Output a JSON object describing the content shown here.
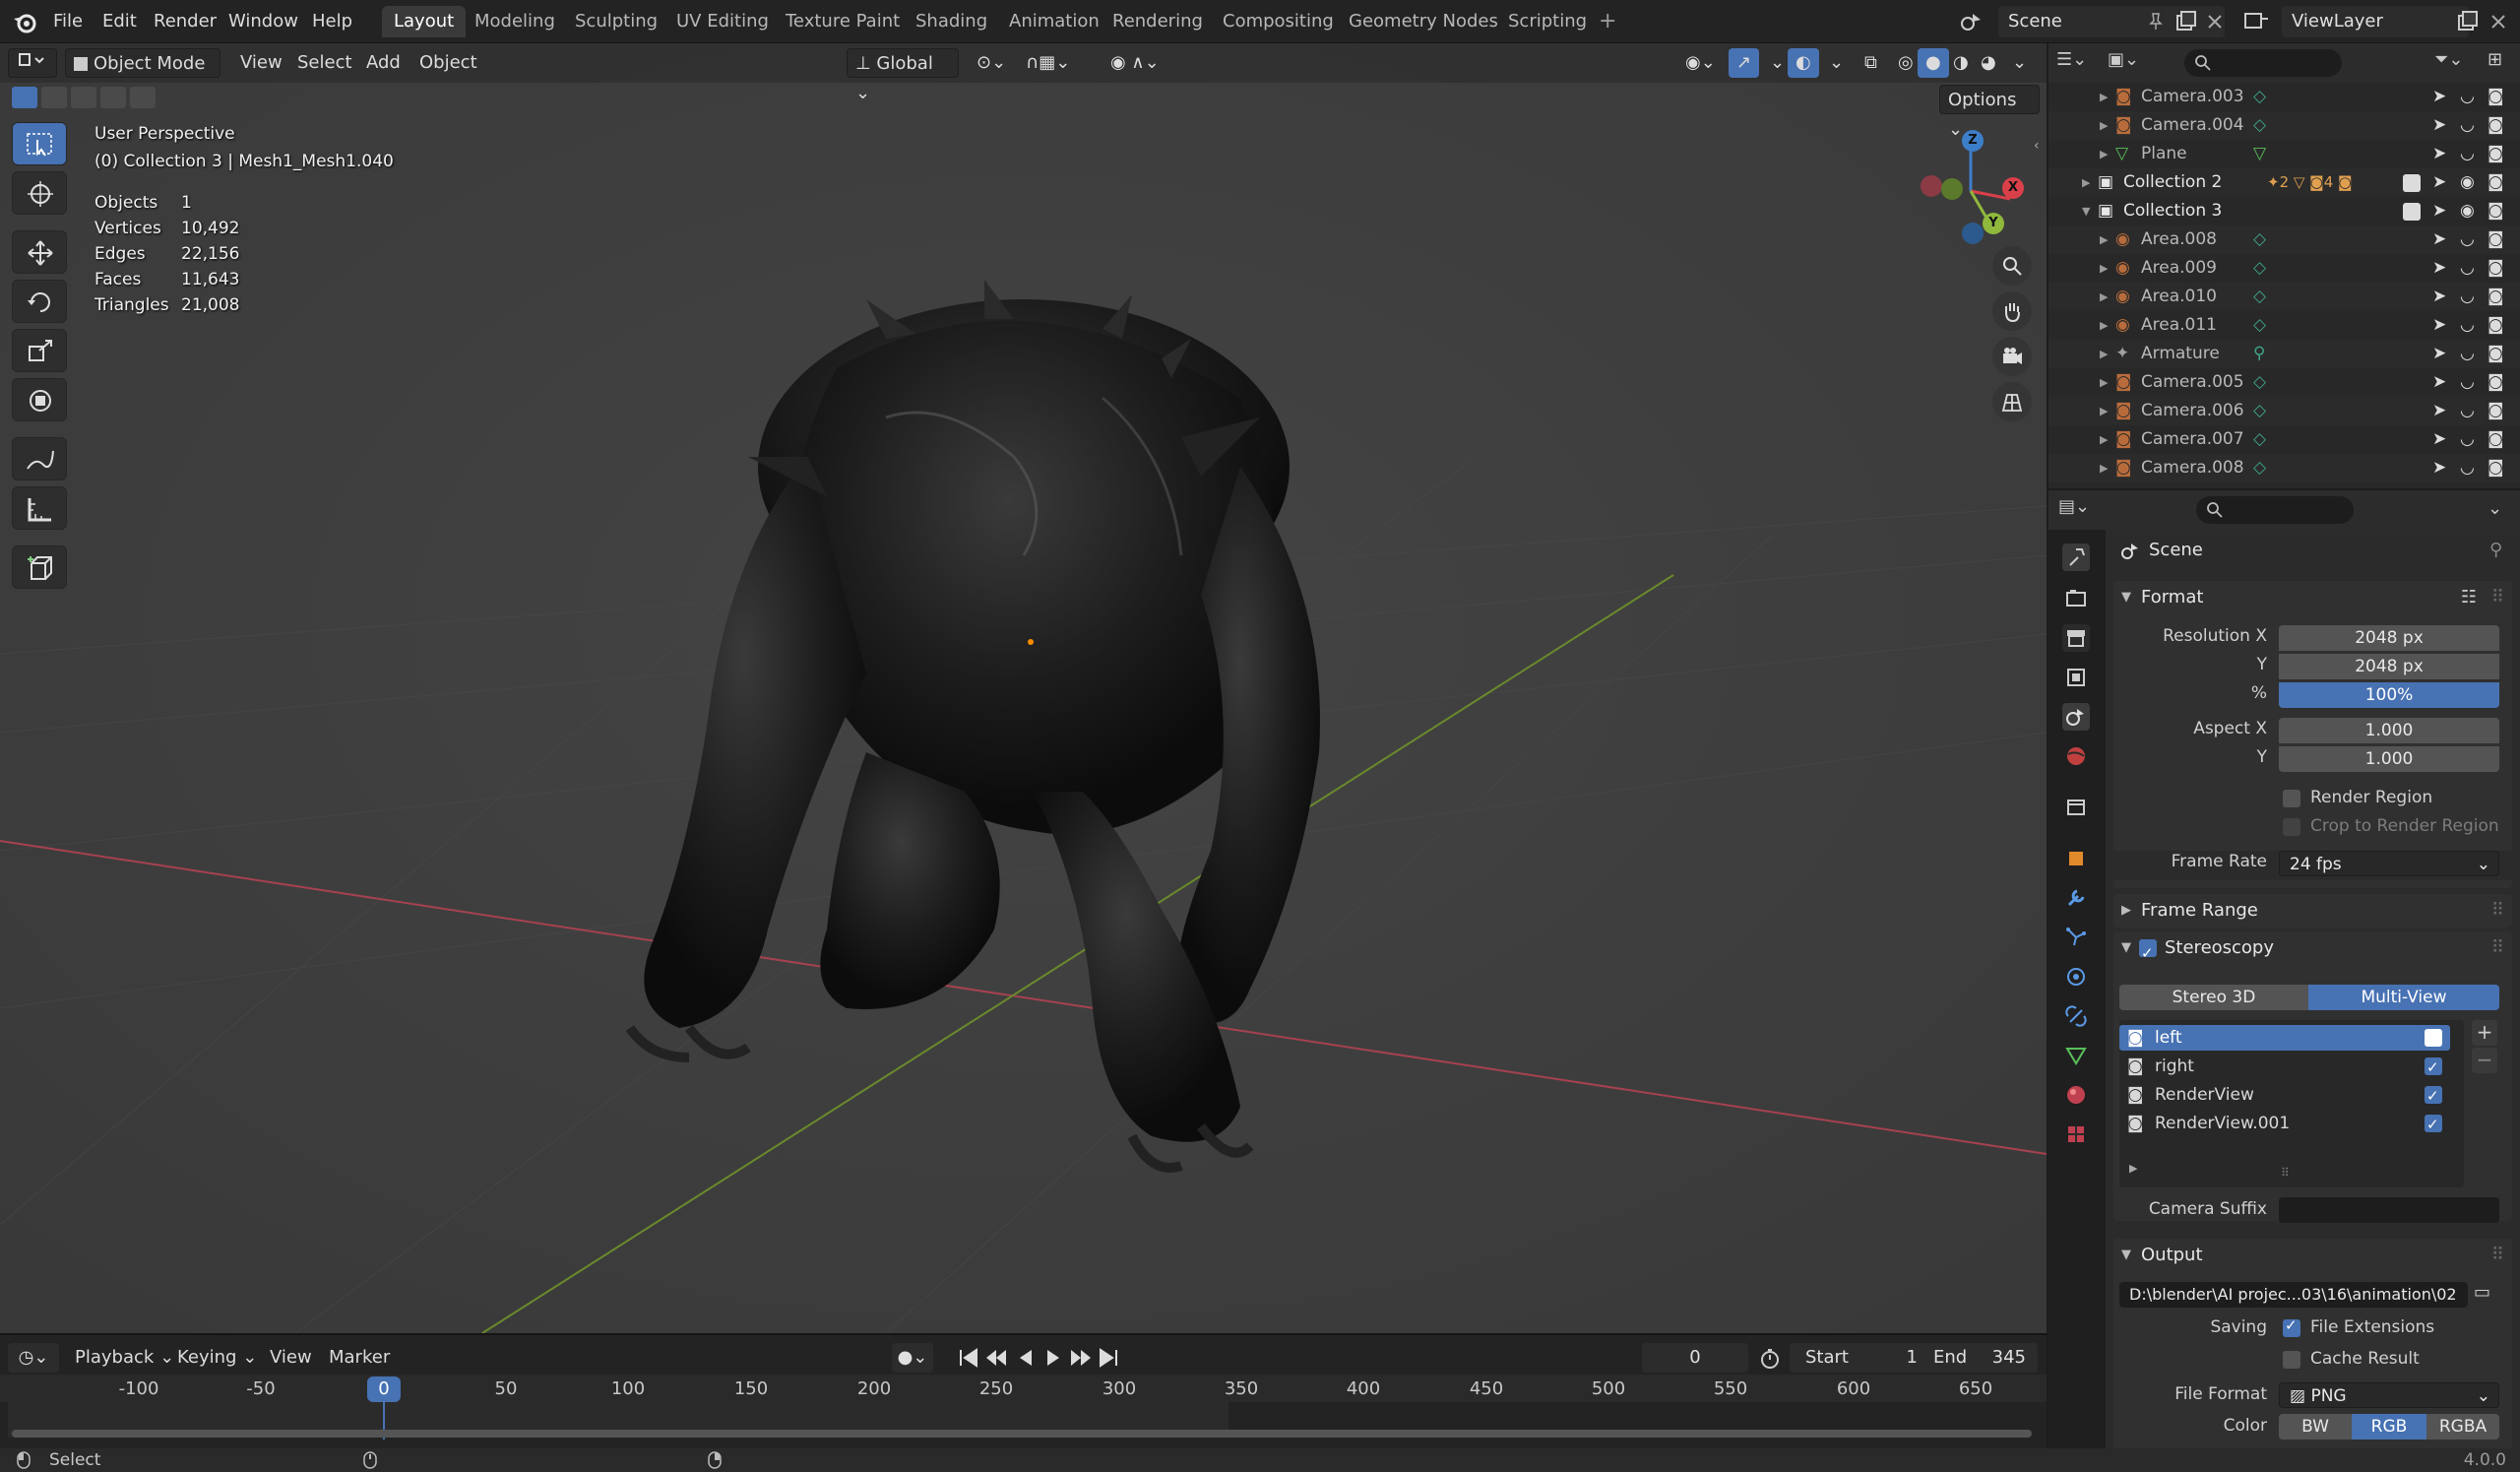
{
  "topbar": {
    "menus": [
      "File",
      "Edit",
      "Render",
      "Window",
      "Help"
    ],
    "workspaces": [
      "Layout",
      "Modeling",
      "Sculpting",
      "UV Editing",
      "Texture Paint",
      "Shading",
      "Animation",
      "Rendering",
      "Compositing",
      "Geometry Nodes",
      "Scripting"
    ],
    "active_workspace": "Layout",
    "add_workspace": "+",
    "scene": "Scene",
    "view_layer": "ViewLayer"
  },
  "viewport": {
    "mode": "Object Mode",
    "menus": [
      "View",
      "Select",
      "Add",
      "Object"
    ],
    "transform_orientation": "Global",
    "options": "Options",
    "view_name": "User Perspective",
    "active_object": "(0) Collection 3 | Mesh1_Mesh1.040",
    "stats": [
      {
        "label": "Objects",
        "value": "1"
      },
      {
        "label": "Vertices",
        "value": "10,492"
      },
      {
        "label": "Edges",
        "value": "22,156"
      },
      {
        "label": "Faces",
        "value": "11,643"
      },
      {
        "label": "Triangles",
        "value": "21,008"
      }
    ],
    "gizmo": {
      "z": "Z",
      "y": "Y",
      "x": "X"
    }
  },
  "timeline": {
    "menus": [
      "Playback",
      "Keying",
      "View",
      "Marker"
    ],
    "current_frame": "0",
    "start_label": "Start",
    "start": "1",
    "end_label": "End",
    "end": "345",
    "ruler": [
      "-100",
      "-50",
      "0",
      "50",
      "100",
      "150",
      "200",
      "250",
      "300",
      "350",
      "400",
      "450",
      "500",
      "550",
      "600",
      "650"
    ]
  },
  "statusbar": {
    "left": "Select",
    "version": "4.0.0"
  },
  "outliner": {
    "rows": [
      {
        "name": "Camera.003",
        "type": "camera"
      },
      {
        "name": "Camera.004",
        "type": "camera"
      },
      {
        "name": "Plane",
        "type": "mesh"
      },
      {
        "name": "Collection 2",
        "type": "collection"
      },
      {
        "name": "Collection 3",
        "type": "collection"
      },
      {
        "name": "Area.008",
        "type": "light"
      },
      {
        "name": "Area.009",
        "type": "light"
      },
      {
        "name": "Area.010",
        "type": "light"
      },
      {
        "name": "Area.011",
        "type": "light"
      },
      {
        "name": "Armature",
        "type": "armature"
      },
      {
        "name": "Camera.005",
        "type": "camera"
      },
      {
        "name": "Camera.006",
        "type": "camera"
      },
      {
        "name": "Camera.007",
        "type": "camera"
      },
      {
        "name": "Camera.008",
        "type": "camera"
      }
    ],
    "collection2_badges": [
      "2",
      "4"
    ]
  },
  "properties": {
    "context": "Scene",
    "format": {
      "title": "Format",
      "resolution_x_label": "Resolution X",
      "resolution_x": "2048 px",
      "y_label": "Y",
      "resolution_y": "2048 px",
      "percent_label": "%",
      "percent": "100%",
      "aspect_x_label": "Aspect X",
      "aspect_x": "1.000",
      "aspect_y_label": "Y",
      "aspect_y": "1.000",
      "render_region": "Render Region",
      "crop": "Crop to Render Region",
      "frame_rate_label": "Frame Rate",
      "frame_rate": "24 fps"
    },
    "frame_range": "Frame Range",
    "stereoscopy": {
      "title": "Stereoscopy",
      "mode_a": "Stereo 3D",
      "mode_b": "Multi-View",
      "views": [
        "left",
        "right",
        "RenderView",
        "RenderView.001"
      ],
      "camera_suffix_label": "Camera Suffix",
      "camera_suffix": ""
    },
    "output": {
      "title": "Output",
      "path": "D:\\blender\\AI projec...03\\16\\animation\\02",
      "saving_label": "Saving",
      "file_extensions": "File Extensions",
      "cache_result": "Cache Result",
      "file_format_label": "File Format",
      "file_format": "PNG",
      "color_label": "Color",
      "color_modes": [
        "BW",
        "RGB",
        "RGBA"
      ]
    }
  }
}
